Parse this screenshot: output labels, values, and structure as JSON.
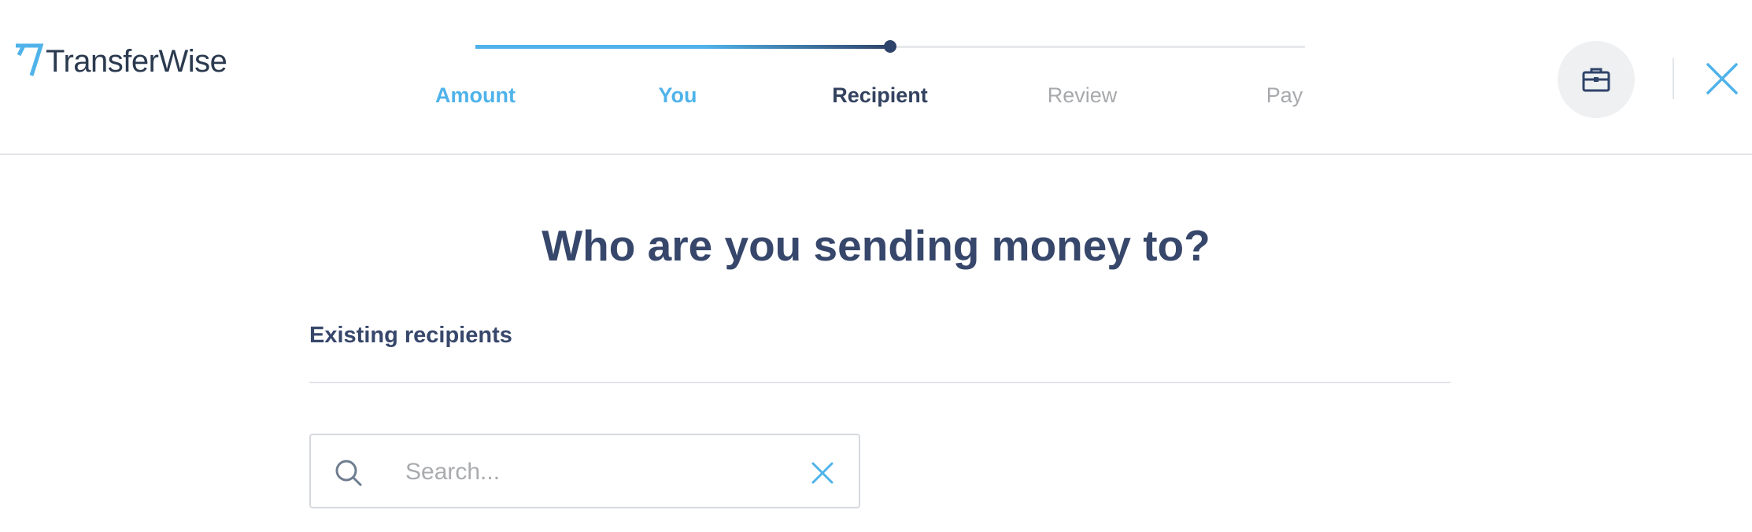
{
  "brand": {
    "name": "TransferWise"
  },
  "steps": [
    {
      "label": "Amount",
      "state": "done"
    },
    {
      "label": "You",
      "state": "done"
    },
    {
      "label": "Recipient",
      "state": "active"
    },
    {
      "label": "Review",
      "state": "todo"
    },
    {
      "label": "Pay",
      "state": "todo"
    }
  ],
  "progress": {
    "current_step": 3,
    "total_steps": 5
  },
  "actions": {
    "business_icon": "briefcase-icon",
    "close_icon": "close-icon"
  },
  "main": {
    "headline": "Who are you sending money to?",
    "section_title": "Existing recipients"
  },
  "search": {
    "placeholder": "Search...",
    "value": ""
  },
  "colors": {
    "accent": "#4fb3ea",
    "navy": "#2e4369",
    "muted": "#a7a9ac"
  }
}
